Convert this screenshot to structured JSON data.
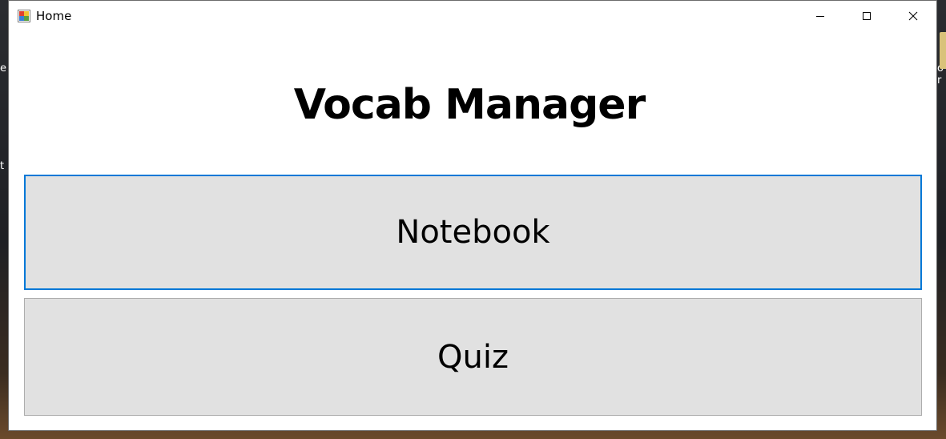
{
  "window": {
    "title": "Home",
    "app_icon": "windows-form-icon",
    "controls": {
      "minimize_icon": "minimize-icon",
      "maximize_icon": "maximize-icon",
      "close_icon": "close-icon"
    }
  },
  "main": {
    "heading": "Vocab Manager",
    "buttons": [
      {
        "label": "Notebook",
        "focused": true
      },
      {
        "label": "Quiz",
        "focused": false
      }
    ]
  },
  "desktop": {
    "edge_glyphs": [
      "e",
      "t",
      "o r"
    ]
  },
  "colors": {
    "focus_border": "#0078d7",
    "button_face": "#e1e1e1",
    "button_border": "#adadad"
  }
}
